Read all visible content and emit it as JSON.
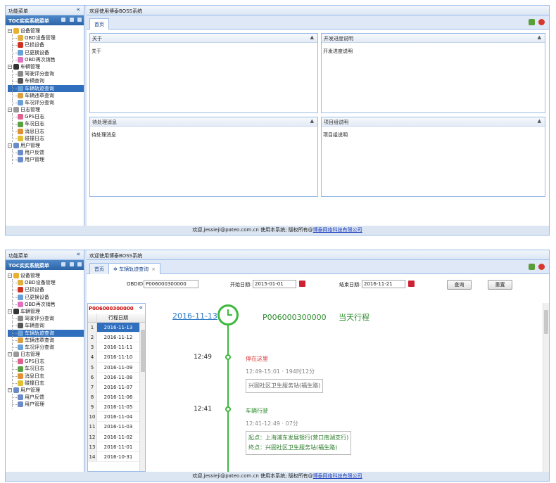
{
  "sidebar": {
    "header": "功能菜单",
    "collapse": "«",
    "title": "TOC实实系统菜单",
    "tree": [
      {
        "label": "设备管理",
        "type": "group",
        "color": "#e8b030"
      },
      {
        "label": "OBD设备管理",
        "type": "child",
        "color": "#e0b040"
      },
      {
        "label": "已损设备",
        "type": "child",
        "color": "#d03020"
      },
      {
        "label": "已更换设备",
        "type": "child",
        "color": "#6aa0d8"
      },
      {
        "label": "OBD再次销售",
        "type": "child",
        "color": "#e070c0"
      },
      {
        "label": "车辆管理",
        "type": "group",
        "color": "#333"
      },
      {
        "label": "驾驶评分查询",
        "type": "child",
        "color": "#888"
      },
      {
        "label": "车辆查询",
        "type": "child",
        "color": "#555"
      },
      {
        "label": "车辆轨迹查询",
        "type": "child",
        "color": "#6aa0d8",
        "selected": true
      },
      {
        "label": "车辆违章查询",
        "type": "child",
        "color": "#d8a040"
      },
      {
        "label": "车况评分查询",
        "type": "child",
        "color": "#6aa0d8"
      },
      {
        "label": "日志管理",
        "type": "group",
        "color": "#999"
      },
      {
        "label": "GPS日志",
        "type": "child",
        "color": "#e06090"
      },
      {
        "label": "车况日志",
        "type": "child",
        "color": "#5aa040"
      },
      {
        "label": "消息日志",
        "type": "child",
        "color": "#e09030"
      },
      {
        "label": "碰撞日志",
        "type": "child",
        "color": "#e0c030"
      },
      {
        "label": "用户管理",
        "type": "group",
        "color": "#6a8ac8"
      },
      {
        "label": "用户反馈",
        "type": "child",
        "color": "#6a8ac8"
      },
      {
        "label": "用户管理",
        "type": "child",
        "color": "#6a8ac8"
      }
    ]
  },
  "main": {
    "header": "欢迎使用博泰BOSS系统",
    "tab_home": "首页",
    "tab_track": "车辆轨迹查询",
    "tab_close": "×"
  },
  "portals": [
    {
      "title": "关于",
      "body": "关于"
    },
    {
      "title": "开发进度说明",
      "body": "开发进度说明"
    },
    {
      "title": "待处理消息",
      "body": "待处理消息"
    },
    {
      "title": "项目组说明",
      "body": "项目组说明"
    }
  ],
  "query": {
    "obd_label": "OBDID:",
    "obd_value": "P006000300000",
    "start_label": "开始日期:",
    "start_value": "2015-01-01",
    "end_label": "结束日期:",
    "end_value": "2016-11-21",
    "search": "查询",
    "reset": "重置"
  },
  "trip_list": {
    "obd": "P006000300000",
    "collapse": "«",
    "col_header": "行程日期",
    "rows": [
      "2016-11-13",
      "2016-11-12",
      "2016-11-11",
      "2016-11-10",
      "2016-11-09",
      "2016-11-08",
      "2016-11-07",
      "2016-11-06",
      "2016-11-05",
      "2016-11-04",
      "2016-11-03",
      "2016-11-02",
      "2016-11-01",
      "2016-10-31"
    ],
    "selected_index": 0
  },
  "timeline": {
    "date": "2016-11-13",
    "obd": "P006000300000",
    "suffix": "当天行程",
    "events": [
      {
        "time": "12:49",
        "title": "停在这里",
        "title_color": "#d83030",
        "sub": "12:49-15:01 · 194时12分",
        "lines": [
          "兴固社区卫生服务站(福生路)"
        ],
        "green": false
      },
      {
        "time": "12:41",
        "title": "车辆行驶",
        "title_color": "#2e8b2e",
        "sub": "12:41-12:49 · 07分",
        "lines": [
          "起点：上海浦东发展银行(营口南湖支行)",
          "终点：兴固社区卫生服务站(福生路)"
        ],
        "green": true
      }
    ]
  },
  "footer": {
    "text": "欢迎,jessieji@pateo.com.cn 使用本系统; 版权所有@",
    "company": "博泰网络科技有限公司"
  }
}
